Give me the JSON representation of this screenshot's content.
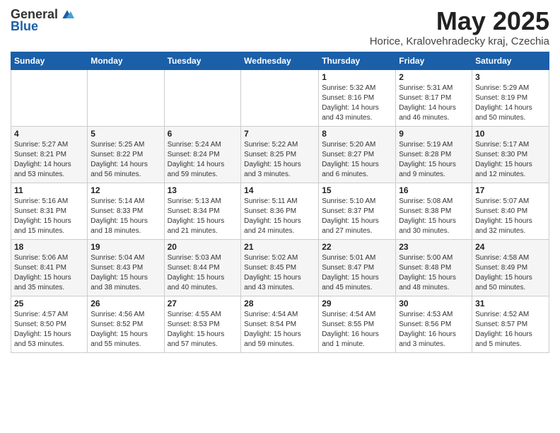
{
  "logo": {
    "general": "General",
    "blue": "Blue"
  },
  "title": "May 2025",
  "location": "Horice, Kralovehradecky kraj, Czechia",
  "days_of_week": [
    "Sunday",
    "Monday",
    "Tuesday",
    "Wednesday",
    "Thursday",
    "Friday",
    "Saturday"
  ],
  "weeks": [
    [
      {
        "day": "",
        "info": ""
      },
      {
        "day": "",
        "info": ""
      },
      {
        "day": "",
        "info": ""
      },
      {
        "day": "",
        "info": ""
      },
      {
        "day": "1",
        "info": "Sunrise: 5:32 AM\nSunset: 8:16 PM\nDaylight: 14 hours\nand 43 minutes."
      },
      {
        "day": "2",
        "info": "Sunrise: 5:31 AM\nSunset: 8:17 PM\nDaylight: 14 hours\nand 46 minutes."
      },
      {
        "day": "3",
        "info": "Sunrise: 5:29 AM\nSunset: 8:19 PM\nDaylight: 14 hours\nand 50 minutes."
      }
    ],
    [
      {
        "day": "4",
        "info": "Sunrise: 5:27 AM\nSunset: 8:21 PM\nDaylight: 14 hours\nand 53 minutes."
      },
      {
        "day": "5",
        "info": "Sunrise: 5:25 AM\nSunset: 8:22 PM\nDaylight: 14 hours\nand 56 minutes."
      },
      {
        "day": "6",
        "info": "Sunrise: 5:24 AM\nSunset: 8:24 PM\nDaylight: 14 hours\nand 59 minutes."
      },
      {
        "day": "7",
        "info": "Sunrise: 5:22 AM\nSunset: 8:25 PM\nDaylight: 15 hours\nand 3 minutes."
      },
      {
        "day": "8",
        "info": "Sunrise: 5:20 AM\nSunset: 8:27 PM\nDaylight: 15 hours\nand 6 minutes."
      },
      {
        "day": "9",
        "info": "Sunrise: 5:19 AM\nSunset: 8:28 PM\nDaylight: 15 hours\nand 9 minutes."
      },
      {
        "day": "10",
        "info": "Sunrise: 5:17 AM\nSunset: 8:30 PM\nDaylight: 15 hours\nand 12 minutes."
      }
    ],
    [
      {
        "day": "11",
        "info": "Sunrise: 5:16 AM\nSunset: 8:31 PM\nDaylight: 15 hours\nand 15 minutes."
      },
      {
        "day": "12",
        "info": "Sunrise: 5:14 AM\nSunset: 8:33 PM\nDaylight: 15 hours\nand 18 minutes."
      },
      {
        "day": "13",
        "info": "Sunrise: 5:13 AM\nSunset: 8:34 PM\nDaylight: 15 hours\nand 21 minutes."
      },
      {
        "day": "14",
        "info": "Sunrise: 5:11 AM\nSunset: 8:36 PM\nDaylight: 15 hours\nand 24 minutes."
      },
      {
        "day": "15",
        "info": "Sunrise: 5:10 AM\nSunset: 8:37 PM\nDaylight: 15 hours\nand 27 minutes."
      },
      {
        "day": "16",
        "info": "Sunrise: 5:08 AM\nSunset: 8:38 PM\nDaylight: 15 hours\nand 30 minutes."
      },
      {
        "day": "17",
        "info": "Sunrise: 5:07 AM\nSunset: 8:40 PM\nDaylight: 15 hours\nand 32 minutes."
      }
    ],
    [
      {
        "day": "18",
        "info": "Sunrise: 5:06 AM\nSunset: 8:41 PM\nDaylight: 15 hours\nand 35 minutes."
      },
      {
        "day": "19",
        "info": "Sunrise: 5:04 AM\nSunset: 8:43 PM\nDaylight: 15 hours\nand 38 minutes."
      },
      {
        "day": "20",
        "info": "Sunrise: 5:03 AM\nSunset: 8:44 PM\nDaylight: 15 hours\nand 40 minutes."
      },
      {
        "day": "21",
        "info": "Sunrise: 5:02 AM\nSunset: 8:45 PM\nDaylight: 15 hours\nand 43 minutes."
      },
      {
        "day": "22",
        "info": "Sunrise: 5:01 AM\nSunset: 8:47 PM\nDaylight: 15 hours\nand 45 minutes."
      },
      {
        "day": "23",
        "info": "Sunrise: 5:00 AM\nSunset: 8:48 PM\nDaylight: 15 hours\nand 48 minutes."
      },
      {
        "day": "24",
        "info": "Sunrise: 4:58 AM\nSunset: 8:49 PM\nDaylight: 15 hours\nand 50 minutes."
      }
    ],
    [
      {
        "day": "25",
        "info": "Sunrise: 4:57 AM\nSunset: 8:50 PM\nDaylight: 15 hours\nand 53 minutes."
      },
      {
        "day": "26",
        "info": "Sunrise: 4:56 AM\nSunset: 8:52 PM\nDaylight: 15 hours\nand 55 minutes."
      },
      {
        "day": "27",
        "info": "Sunrise: 4:55 AM\nSunset: 8:53 PM\nDaylight: 15 hours\nand 57 minutes."
      },
      {
        "day": "28",
        "info": "Sunrise: 4:54 AM\nSunset: 8:54 PM\nDaylight: 15 hours\nand 59 minutes."
      },
      {
        "day": "29",
        "info": "Sunrise: 4:54 AM\nSunset: 8:55 PM\nDaylight: 16 hours\nand 1 minute."
      },
      {
        "day": "30",
        "info": "Sunrise: 4:53 AM\nSunset: 8:56 PM\nDaylight: 16 hours\nand 3 minutes."
      },
      {
        "day": "31",
        "info": "Sunrise: 4:52 AM\nSunset: 8:57 PM\nDaylight: 16 hours\nand 5 minutes."
      }
    ]
  ]
}
